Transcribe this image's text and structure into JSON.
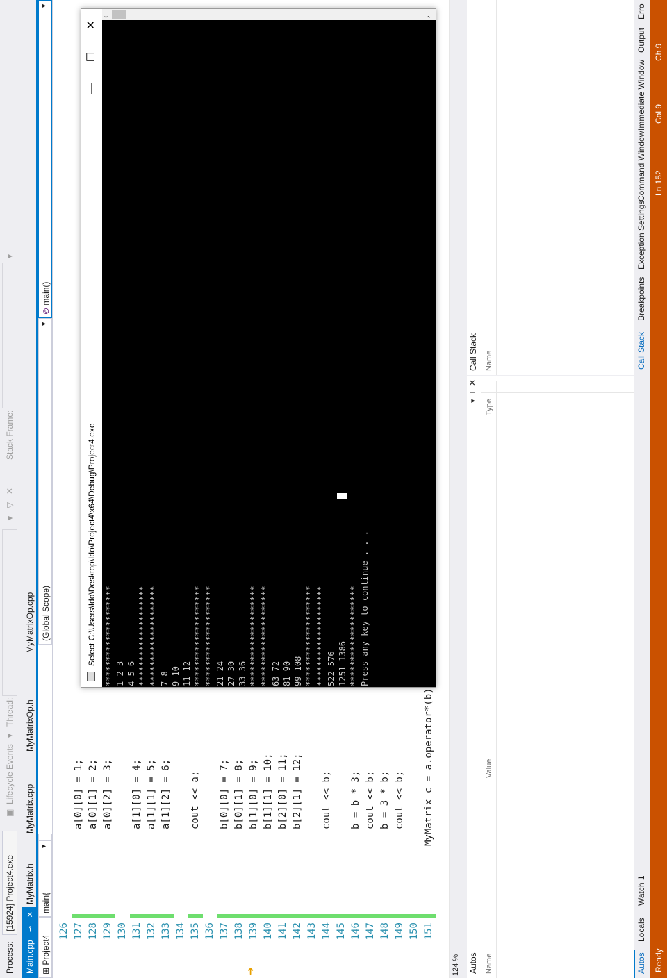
{
  "debug_toolbar": {
    "process_label": "Process:",
    "process_value": "[15924] Project4.exe",
    "lifecycle_label": "Lifecycle Events",
    "thread_label": "Thread:",
    "stack_frame_label": "Stack Frame:"
  },
  "tabs": [
    {
      "label": "Main.cpp",
      "active": true
    },
    {
      "label": "MyMatrix.h",
      "active": false
    },
    {
      "label": "MyMatrix.cpp",
      "active": false
    },
    {
      "label": "MyMatrixOp.h",
      "active": false
    },
    {
      "label": "MyMatrixOp.cpp",
      "active": false
    }
  ],
  "navbar": {
    "project": "Project4",
    "scope": "(Global Scope)",
    "function": "main()",
    "member": "main{"
  },
  "editor": {
    "zoom": "124 %",
    "lines": [
      {
        "n": "126",
        "code": ""
      },
      {
        "n": "127",
        "code": "a[0][0] = 1;"
      },
      {
        "n": "128",
        "code": "a[0][1] = 2;"
      },
      {
        "n": "129",
        "code": "a[0][2] = 3;"
      },
      {
        "n": "130",
        "code": ""
      },
      {
        "n": "131",
        "code": "a[1][0] = 4;"
      },
      {
        "n": "132",
        "code": "a[1][1] = 5;"
      },
      {
        "n": "133",
        "code": "a[1][2] = 6;"
      },
      {
        "n": "134",
        "code": ""
      },
      {
        "n": "135",
        "code": "cout << a;"
      },
      {
        "n": "136",
        "code": ""
      },
      {
        "n": "137",
        "code": "b[0][0] = 7;"
      },
      {
        "n": "138",
        "code": "b[0][1] = 8;"
      },
      {
        "n": "139",
        "code": "b[1][0] = 9;"
      },
      {
        "n": "140",
        "code": "b[1][1] = 10;"
      },
      {
        "n": "141",
        "code": "b[2][0] = 11;"
      },
      {
        "n": "142",
        "code": "b[2][1] = 12;"
      },
      {
        "n": "143",
        "code": ""
      },
      {
        "n": "144",
        "code": "cout << b;"
      },
      {
        "n": "145",
        "code": ""
      },
      {
        "n": "146",
        "code": "b = b * 3;"
      },
      {
        "n": "147",
        "code": "cout << b;"
      },
      {
        "n": "148",
        "code": "b = 3 * b;"
      },
      {
        "n": "149",
        "code": "cout << b;"
      },
      {
        "n": "150",
        "code": ""
      },
      {
        "n": "151",
        "code": "MyMatrix c = a.operator*(b);"
      }
    ]
  },
  "console": {
    "title": "Select C:\\Users\\Ido\\Desktop\\Ido\\Project4\\x64\\Debug\\Project4.exe",
    "minimize": "—",
    "maximize": "☐",
    "close": "✕",
    "lines": [
      "********************",
      "1 2 3",
      "4 5 6",
      "********************",
      "********************",
      "7 8",
      "9 10",
      "11 12",
      "********************",
      "********************",
      "21 24",
      "27 30",
      "33 36",
      "********************",
      "********************",
      "63 72",
      "81 90",
      "99 108",
      "********************",
      "********************",
      "522 576",
      "1251 1386",
      "********************",
      "Press any key to continue . . ."
    ]
  },
  "autos_panel": {
    "title": "Autos",
    "col_name": "Name",
    "col_value": "Value",
    "col_type": "Type",
    "tabs": [
      "Autos",
      "Locals",
      "Watch 1"
    ]
  },
  "callstack_panel": {
    "title": "Call Stack",
    "col_name": "Name",
    "tabs": [
      "Call Stack",
      "Breakpoints",
      "Exception Settings",
      "Command Window",
      "Immediate Window",
      "Output",
      "Erro"
    ]
  },
  "status": {
    "ready": "Ready",
    "ln": "Ln 152",
    "col": "Col 9",
    "ch": "Ch 9"
  },
  "colors": {
    "accent": "#007acc",
    "status_bar": "#ca5100",
    "change_bar": "#6ede6e",
    "line_numbers": "#2b91af"
  }
}
